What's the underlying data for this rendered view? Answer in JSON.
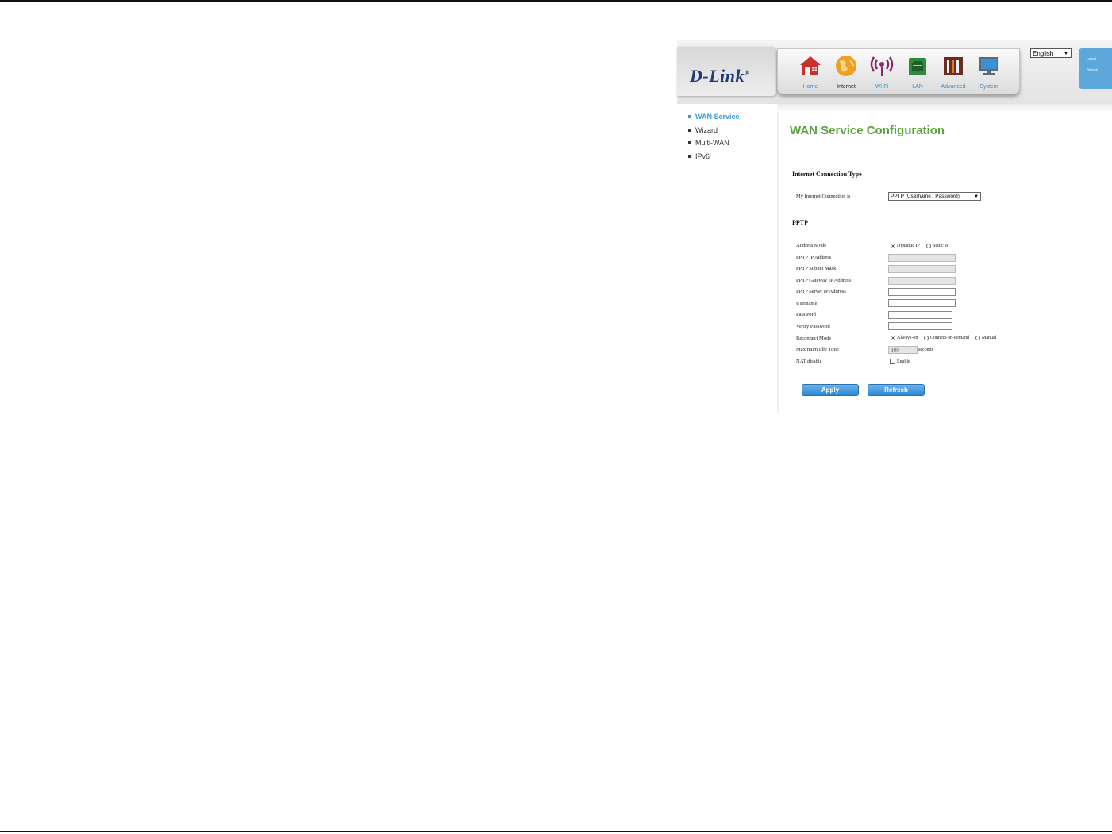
{
  "brand": {
    "logo": "D-Link"
  },
  "nav": {
    "items": [
      {
        "label": "Home",
        "icon": "house-icon"
      },
      {
        "label": "Internet",
        "icon": "globe-icon",
        "active": true
      },
      {
        "label": "Wi-Fi",
        "icon": "wifi-icon"
      },
      {
        "label": "LAN",
        "icon": "lan-icon"
      },
      {
        "label": "Advanced",
        "icon": "toolbox-icon"
      },
      {
        "label": "System",
        "icon": "monitor-icon"
      }
    ]
  },
  "language": {
    "selected": "English"
  },
  "side_panel": {
    "logout": "Logout",
    "refresh": "Refresh"
  },
  "menu": {
    "items": [
      {
        "label": "WAN Service",
        "active": true
      },
      {
        "label": "Wizard"
      },
      {
        "label": "Multi-WAN"
      },
      {
        "label": "IPv6"
      }
    ]
  },
  "page": {
    "title": "WAN Service Configuration"
  },
  "connection": {
    "section_title": "Internet Connection Type",
    "label": "My Internet Connection is",
    "selected": "PPTP (Username / Password)"
  },
  "pptp": {
    "section_title": "PPTP",
    "address_mode_label": "Address Mode",
    "address_mode_options": [
      "Dynamic IP",
      "Static IP"
    ],
    "address_mode_selected": "Dynamic IP",
    "ip_address_label": "PPTP IP Address",
    "subnet_mask_label": "PPTP Subnet Mask",
    "gateway_label": "PPTP Gateway IP Address",
    "server_ip_label": "PPTP Server IP Address",
    "username_label": "Username",
    "password_label": "Password",
    "verify_password_label": "Verify Password",
    "reconnect_mode_label": "Reconnect Mode",
    "reconnect_options": [
      "Always-on",
      "Connect-on-demand",
      "Manual"
    ],
    "reconnect_selected": "Always-on",
    "idle_time_label": "Maximum Idle Time",
    "idle_time_value": "300",
    "idle_time_unit": "seconds",
    "nat_label": "NAT disable",
    "nat_option": "Enable",
    "nat_checked": false
  },
  "buttons": {
    "apply": "Apply",
    "refresh": "Refresh"
  },
  "colors": {
    "accent_blue": "#3a9bd5",
    "title_green": "#5aa43c",
    "button_blue": "#2d86cf"
  }
}
